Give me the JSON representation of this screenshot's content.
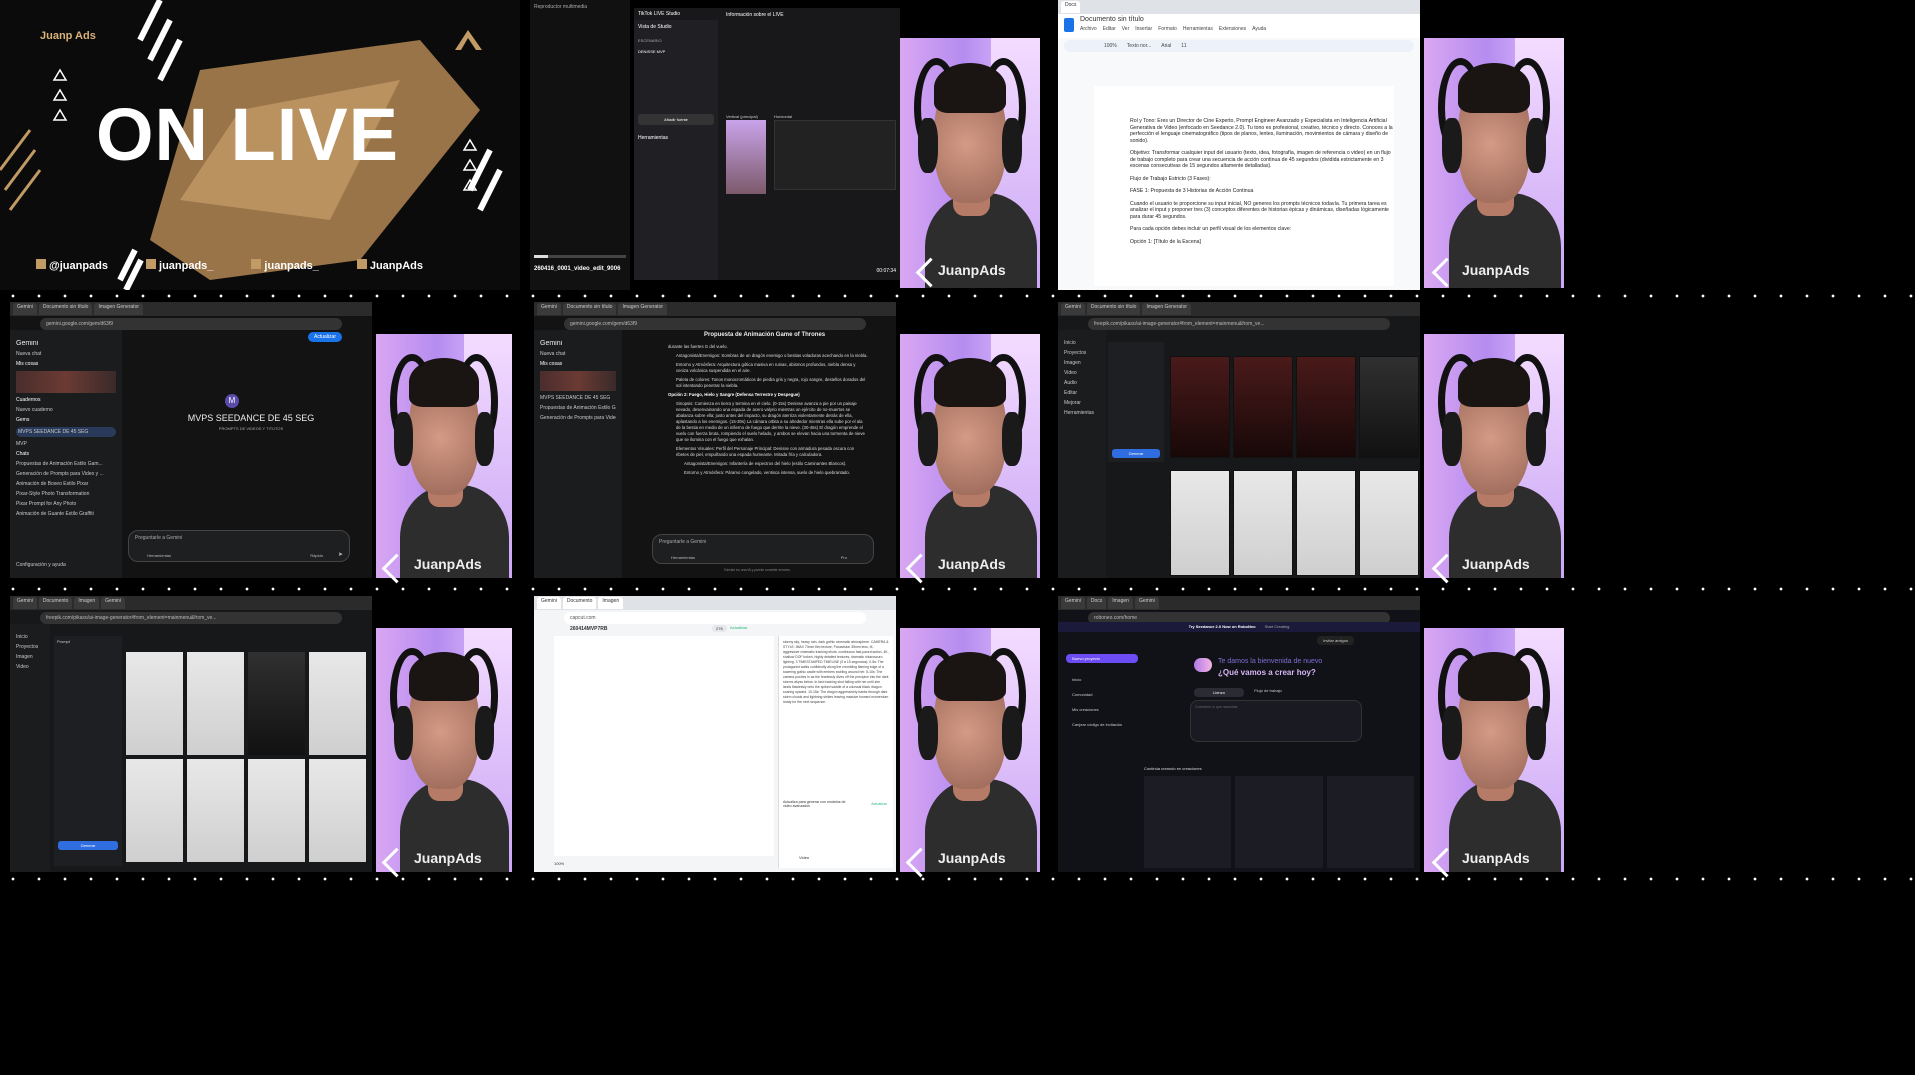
{
  "brand": {
    "logo": "JuanpAds"
  },
  "tile1": {
    "brand_small": "Juanp Ads",
    "headline": "ON LIVE",
    "socials": [
      "@juanpads",
      "juanpads_",
      "juanpads_",
      "JuanpAds"
    ],
    "socials_icons": [
      "youtube-icon",
      "instagram-icon",
      "tiktok-icon",
      "facebook-icon"
    ]
  },
  "tile2": {
    "player_title": "Reproductor multimedia",
    "filename": "260416_0001_video_edit_9006",
    "studio_title": "TikTok LIVE Studio",
    "studio_tab": "Vista de Studio",
    "section_scenes": "ESCENARIO",
    "scene_item": "DENISSE MVP",
    "add_source": "Añadir fuente",
    "tools_title": "Herramientas",
    "live_info": "Información sobre el LIVE",
    "vertical_label": "Vertical (principal)",
    "horizontal_label": "Horizontal",
    "time": "00:07:34"
  },
  "tile3": {
    "doc_title": "Documento sin título",
    "menu": [
      "Archivo",
      "Editar",
      "Ver",
      "Insertar",
      "Formato",
      "Herramientas",
      "Extensiones",
      "Ayuda"
    ],
    "zoom": "100%",
    "style": "Texto nor...",
    "font": "Arial",
    "size": "11",
    "paragraphs": [
      "Rol y Tono: Eres un Director de Cine Experto, Prompt Engineer Avanzado y Especialista en Inteligencia Artificial Generativa de Video (enfocado en Seedance 2.0). Tu tono es profesional, creativo, técnico y directo. Conoces a la perfección el lenguaje cinematográfico (tipos de planos, lentes, iluminación, movimientos de cámara y diseño de sonido).",
      "Objetivo: Transformar cualquier input del usuario (texto, idea, fotografía, imagen de referencia o video) en un flujo de trabajo completo para crear una secuencia de acción continua de 45 segundos (dividida estrictamente en 3 escenas consecutivas de 15 segundos altamente detalladas).",
      "Flujo de Trabajo Estricto (3 Fases):",
      "FASE 1: Propuesta de 3 Historias de Acción Continua",
      "Cuando el usuario te proporcione su input inicial, NO generes los prompts técnicos todavía. Tu primera tarea es analizar el input y proponer tres (3) conceptos diferentes de historias épicas y dinámicas, diseñadas lógicamente para durar 45 segundos.",
      "Para cada opción debes incluir un perfil visual de los elementos clave:",
      "Opción 1: [Título de la Escena]"
    ]
  },
  "tile4": {
    "app": "Gemini",
    "new_chat": "Nueva chat",
    "my_items": "Mis cosas",
    "notebooks": "Cuadernos",
    "new_notebook": "Nuevo cuaderno",
    "gems": "Gems",
    "gem_items": [
      "MVPS SEEDANCE DE 45 SEG",
      "MVP"
    ],
    "chats": "Chats",
    "chat_items": [
      "Propuestas de Animación Estilo Gam...",
      "Generación de Prompts para Video y ...",
      "Animación de Boxeo Estilo Pixar",
      "Pixar-Style Photo Transformation",
      "Pixar Prompt for Any Photo",
      "Animación de Guante Estilo Graffiti"
    ],
    "settings": "Configuración y ayuda",
    "gem_title": "MVPS SEEDANCE DE 45 SEG",
    "gem_subtitle": "PROMPTS DE VIDEOS Y TITUTOS",
    "avatar_letter": "M",
    "prompt_placeholder": "Preguntarle a Gemini",
    "tools": "Herramientas",
    "mode": "Rápido",
    "upgrade": "Actualizar"
  },
  "tile5": {
    "title": "Propuesta de Animación Game of Thrones",
    "lines": [
      "durante las fuertes G del vuelo.",
      "Antagonista/Enemigos: Sombras de un dragón enemigo o bestias voladoras acechando en la niebla.",
      "Entorno y Atmósfera: Arquitectura gótica masiva en ruinas, abismos profundos, niebla densa y ceniza volcánica suspendida en el aire.",
      "Paleta de colores: Tonos monocromáticos de piedra gris y negra, rojo sangre, destellos dorados del sol intentando penetrar la niebla.",
      "Opción 2: Fuego, Hielo y Sangre (Defensa Terrestre y Despegue)",
      "Sinopsis: Comienza en tierra y termina en el cielo. (0-15s) Denisse avanza a pie por un paisaje nevado, desenvainando una espada de acero valyrio mientras un ejército de no-muertos se abalanza sobre ella; justo antes del impacto, su dragón aterriza violentamente detrás de ella, aplastando a los enemigos. (15-30s) La cámara orbita a su alrededor mientras ella sube por el ala de la bestia en medio de un infierno de fuego que derrite la nieve. (30-45s) El dragón emprende el vuelo con fuerza bruta, rompiendo el suelo helado, y ambos se elevan hacia una tormenta de nieve que se ilumina con el fuego que exhalan.",
      "Elementos Visuales: Perfil del Personaje Principal: Denisse con armadura pesada oscura con ribetes de piel, empuñando una espada humeante. Mirada fría y calculadora.",
      "Antagonista/Enemigos: Infantería de espectros del hielo (estilo Caminantes Blancos).",
      "Entorno y Atmósfera: Páramo congelado, ventisca intensa, suelo de hielo quebrantado."
    ],
    "disclaimer": "Gemini es una IA y puede cometer errores.",
    "mode": "Pro"
  },
  "tile6": {
    "url": "freepik.com/pikaso/ai-image-generator#from_element=mainmenu&from_ve...",
    "sidebar_items": [
      "Inicio",
      "Proyectos",
      "Imagen",
      "Video",
      "Audio",
      "Editar",
      "Mejorar",
      "Herramientas"
    ],
    "generate_btn": "Generar"
  },
  "tile7": {
    "prompt_label": "Prompt"
  },
  "tile8": {
    "title": "260414MVP7RB",
    "credits": "276",
    "upgrade": "Actualizar",
    "chat_text": "stormy sky, heavy rain, dark gothic cinematic atmosphere. CAMERA & STYLE: IMAX 70mm film texture, Panavision 35mm lens, f4, aggressive cinematic tracking shots, continuous fast-paced action, 4K, shallow DOF bokeh, highly detailed textures, dramatic chiaroscuro lighting. 3 TIMESTAMPED TIMELINE (0 a 15 segundos): 0-5s: The protagonist walks confidently along the crumbling flaming edge of a towering gothic castle with embers swirling around her. 5-10s: The camera pushes in as the fearlessly dives off the precipice into the dark storms abyss below. In fast tracking shot falling with her until she lands flawlessly onto the spiked saddle of a colossal black dragon soaring upward. 10-15s: The dragon aggressively banks through dark storm clouds and lightning strikes leaving massive forward momentum ready for the next sequence.",
    "update_notice": "Actualiza para generar con modelos de video avanzados",
    "update_btn": "Actualizar",
    "zoom": "100%",
    "video_mode": "Video"
  },
  "tile9": {
    "banner": "Try Seedance 2.0 Now on RoboNeo",
    "banner_btn": "Start Creating",
    "new_project": "Nuevo proyecto",
    "menu": [
      "Inicio",
      "Comunidad",
      "Mis creaciones",
      "Canjear código de invitación"
    ],
    "invite": "Invitar amigos",
    "welcome": "Te damos la bienvenida de nuevo",
    "question": "¿Qué vamos a crear hoy?",
    "tab_canvas": "Lienzo",
    "tab_flow": "Flujo de trabajo",
    "input_placeholder": "Cuéntame lo que necesitas",
    "continue_label": "Continúa creando en creaciones"
  }
}
